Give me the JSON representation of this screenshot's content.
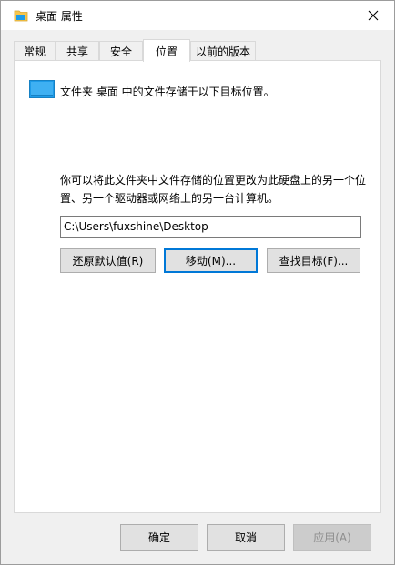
{
  "window": {
    "title": "桌面 属性"
  },
  "tabs": [
    {
      "label": "常规"
    },
    {
      "label": "共享"
    },
    {
      "label": "安全"
    },
    {
      "label": "位置"
    },
    {
      "label": "以前的版本"
    }
  ],
  "location": {
    "description": "文件夹 桌面 中的文件存储于以下目标位置。",
    "info": "你可以将此文件夹中文件存储的位置更改为此硬盘上的另一个位置、另一个驱动器或网络上的另一台计算机。",
    "path_value": "C:\\Users\\fuxshine\\Desktop",
    "restore_label": "还原默认值(R)",
    "move_label": "移动(M)...",
    "find_label": "查找目标(F)..."
  },
  "footer": {
    "ok_label": "确定",
    "cancel_label": "取消",
    "apply_label": "应用(A)"
  },
  "colors": {
    "active_tab": "#ffffff",
    "focus_border": "#0078d7",
    "folder_blue": "#1e9be8"
  }
}
